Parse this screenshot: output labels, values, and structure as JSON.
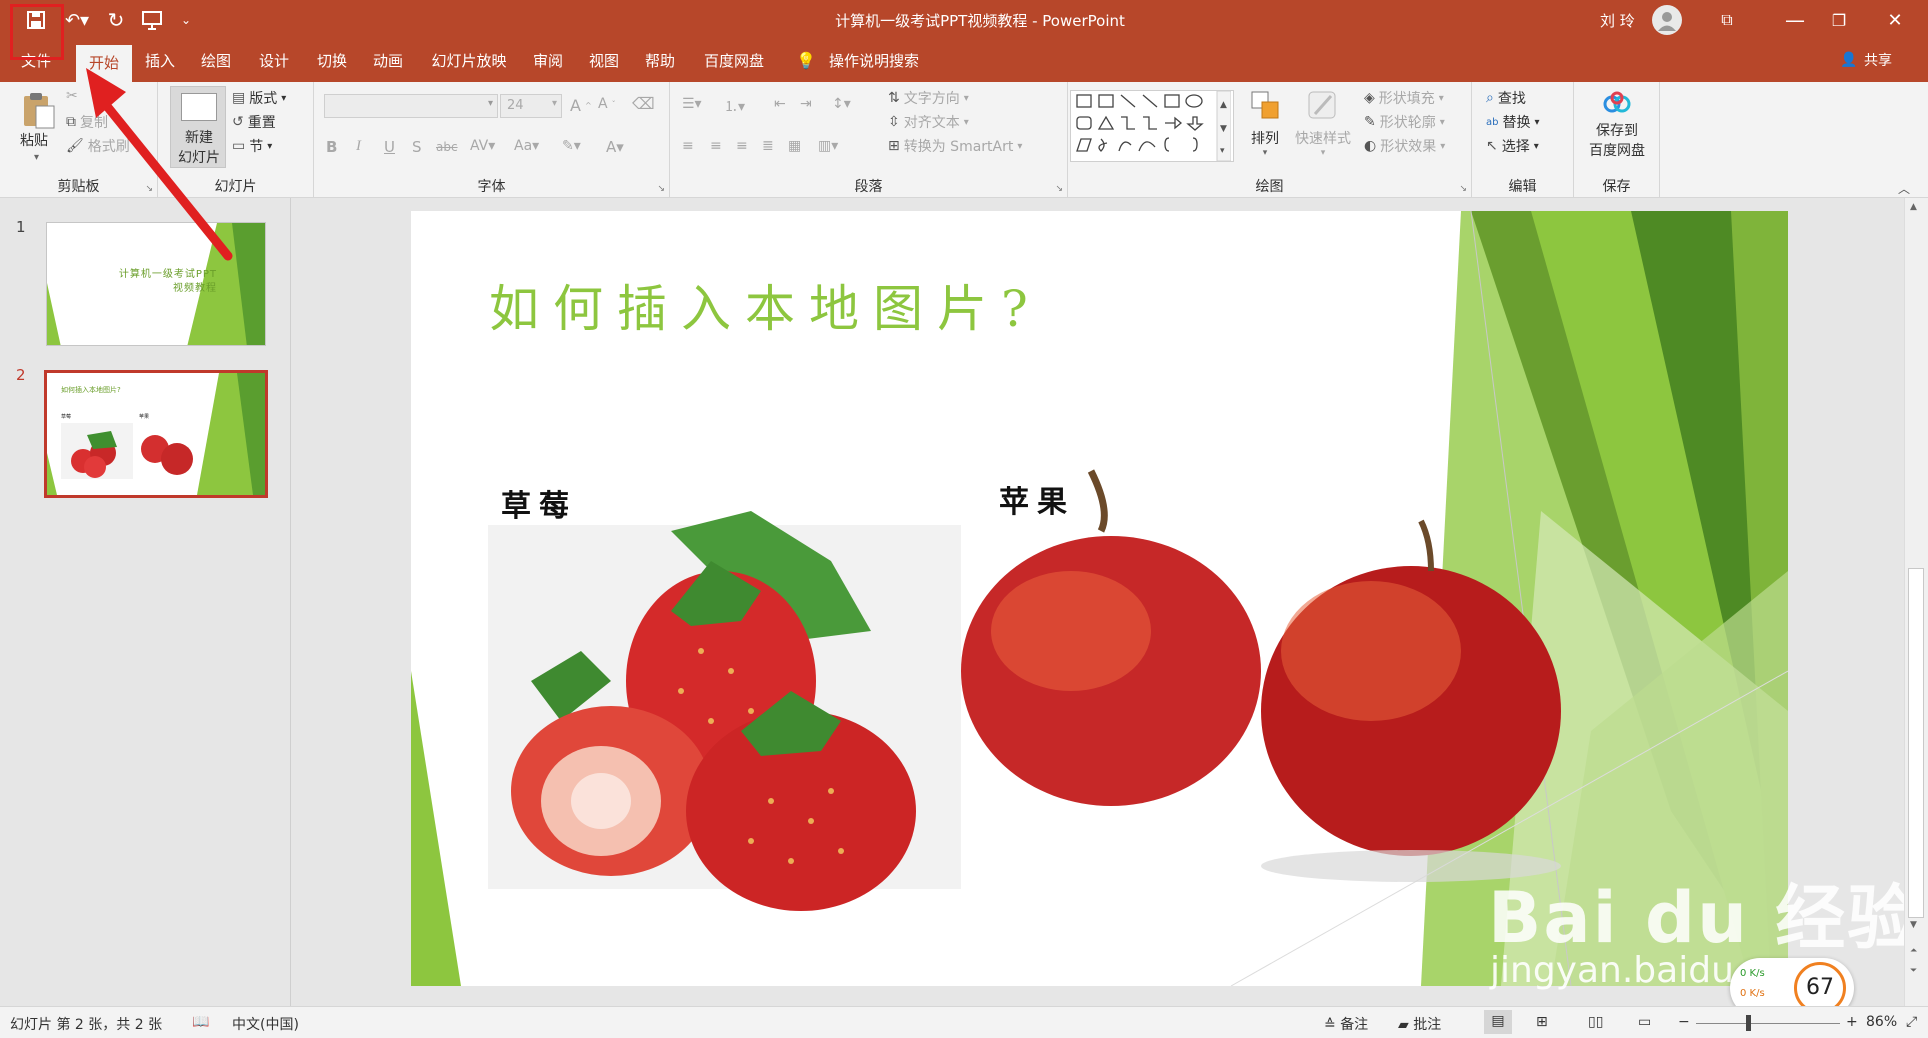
{
  "window": {
    "title": "计算机一级考试PPT视频教程 - PowerPoint",
    "user": "刘 玲"
  },
  "tabs": [
    {
      "label": "文件"
    },
    {
      "label": "开始"
    },
    {
      "label": "插入"
    },
    {
      "label": "绘图"
    },
    {
      "label": "设计"
    },
    {
      "label": "切换"
    },
    {
      "label": "动画"
    },
    {
      "label": "幻灯片放映"
    },
    {
      "label": "审阅"
    },
    {
      "label": "视图"
    },
    {
      "label": "帮助"
    },
    {
      "label": "百度网盘"
    }
  ],
  "tell_me": "操作说明搜索",
  "share": "共享",
  "ribbon": {
    "clipboard": {
      "label": "剪贴板",
      "paste": "粘贴",
      "copy": "复制",
      "format_painter": "格式刷"
    },
    "slides": {
      "label": "幻灯片",
      "new_slide_1": "新建",
      "new_slide_2": "幻灯片",
      "layout": "版式",
      "reset": "重置",
      "section": "节"
    },
    "font": {
      "label": "字体",
      "font_size": "24"
    },
    "paragraph": {
      "label": "段落",
      "text_direction": "文字方向",
      "align_text": "对齐文本",
      "convert_smartart": "转换为 SmartArt"
    },
    "drawing": {
      "label": "绘图",
      "arrange": "排列",
      "quick_styles": "快速样式",
      "shape_fill": "形状填充",
      "shape_outline": "形状轮廓",
      "shape_effects": "形状效果"
    },
    "editing": {
      "label": "编辑",
      "find": "查找",
      "replace": "替换",
      "select": "选择"
    },
    "save": {
      "label": "保存",
      "save_to_1": "保存到",
      "save_to_2": "百度网盘"
    }
  },
  "thumbnails": [
    {
      "number": "1",
      "title_line1": "计算机一级考试PPT",
      "title_line2": "视频教程"
    },
    {
      "number": "2",
      "title": "如何插入本地图片?",
      "label1": "草莓",
      "label2": "苹果"
    }
  ],
  "slide": {
    "title": "如何插入本地图片?",
    "caption_left": "草莓",
    "caption_right": "苹果"
  },
  "watermark": {
    "line1": "Bai du 经验",
    "line2": "jingyan.baidu.com"
  },
  "net_widget": {
    "up": "0 K/s",
    "down": "0 K/s",
    "percent": "67"
  },
  "status": {
    "slide_info": "幻灯片 第 2 张，共 2 张",
    "language": "中文(中国)",
    "notes": "备注",
    "comments": "批注",
    "zoom": "86%"
  },
  "colors": {
    "accent": "#b7472a",
    "slide_green": "#8dc63f",
    "highlight_red": "#e02020"
  }
}
